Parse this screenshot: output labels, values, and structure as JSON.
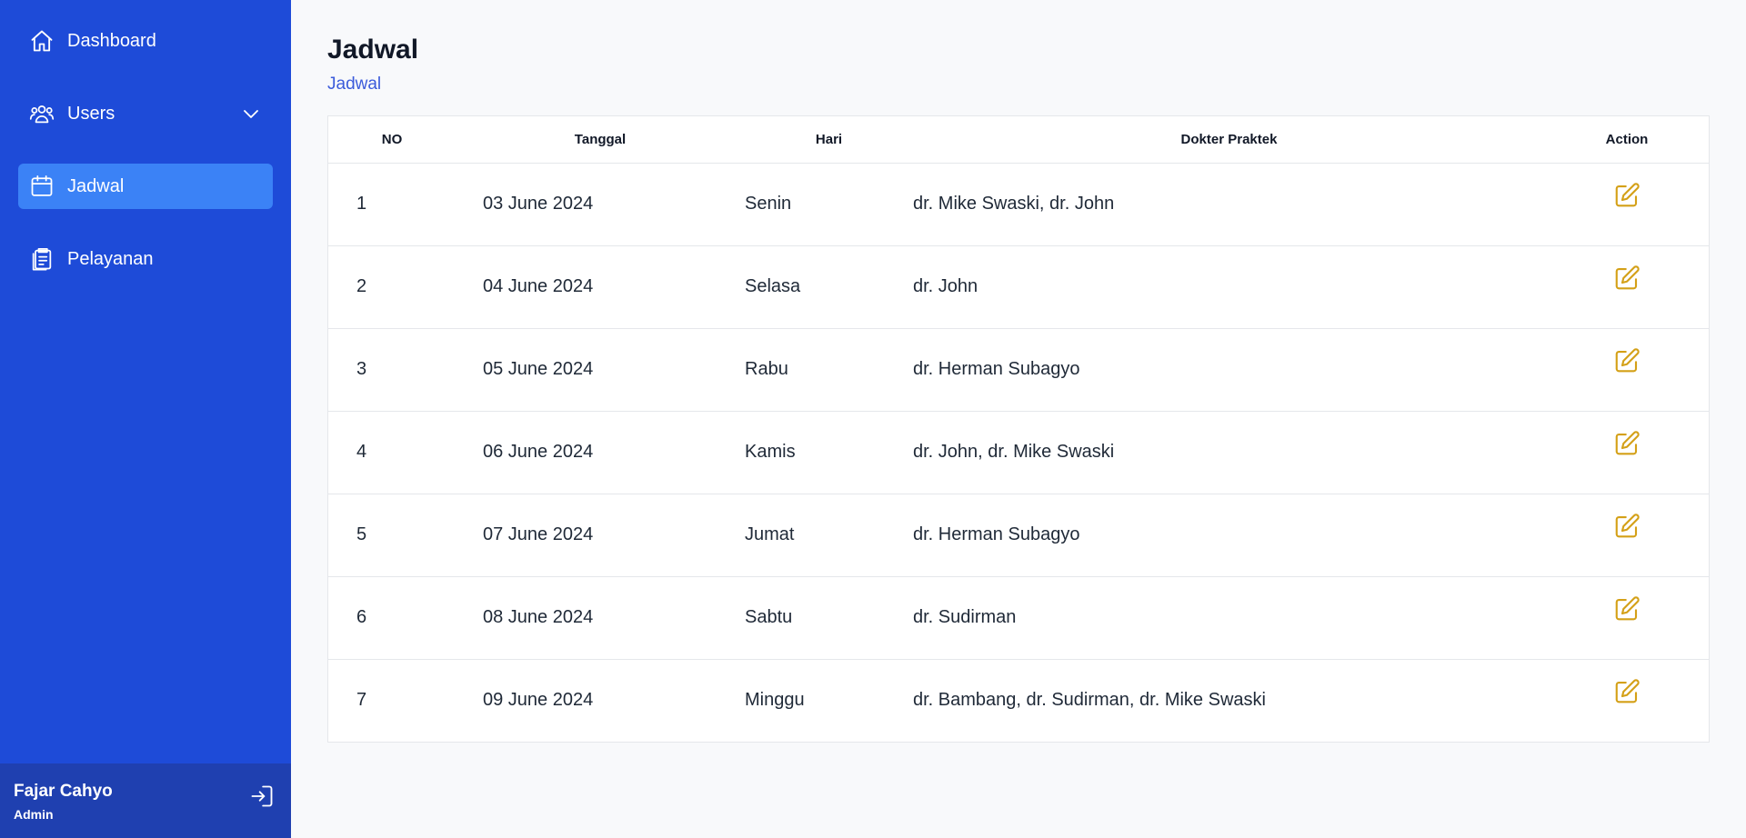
{
  "sidebar": {
    "items": [
      {
        "label": "Dashboard",
        "icon": "home-icon"
      },
      {
        "label": "Users",
        "icon": "users-icon",
        "has_dropdown": true
      },
      {
        "label": "Jadwal",
        "icon": "calendar-icon",
        "active": true
      },
      {
        "label": "Pelayanan",
        "icon": "clipboard-icon"
      }
    ],
    "user": {
      "name": "Fajar Cahyo",
      "role": "Admin"
    }
  },
  "page": {
    "title": "Jadwal",
    "breadcrumb": "Jadwal"
  },
  "table": {
    "headers": {
      "no": "NO",
      "tanggal": "Tanggal",
      "hari": "Hari",
      "dokter": "Dokter Praktek",
      "action": "Action"
    },
    "rows": [
      {
        "no": "1",
        "tanggal": "03 June 2024",
        "hari": "Senin",
        "dokter": "dr. Mike Swaski, dr. John"
      },
      {
        "no": "2",
        "tanggal": "04 June 2024",
        "hari": "Selasa",
        "dokter": "dr. John"
      },
      {
        "no": "3",
        "tanggal": "05 June 2024",
        "hari": "Rabu",
        "dokter": "dr. Herman Subagyo"
      },
      {
        "no": "4",
        "tanggal": "06 June 2024",
        "hari": "Kamis",
        "dokter": "dr. John, dr. Mike Swaski"
      },
      {
        "no": "5",
        "tanggal": "07 June 2024",
        "hari": "Jumat",
        "dokter": "dr. Herman Subagyo"
      },
      {
        "no": "6",
        "tanggal": "08 June 2024",
        "hari": "Sabtu",
        "dokter": "dr. Sudirman"
      },
      {
        "no": "7",
        "tanggal": "09 June 2024",
        "hari": "Minggu",
        "dokter": "dr. Bambang, dr. Sudirman, dr. Mike Swaski"
      }
    ]
  },
  "colors": {
    "sidebar_bg": "#1e4bd8",
    "active_item": "#3b82f6",
    "user_bg": "#1f40b0",
    "edit_icon": "#d4a017",
    "breadcrumb": "#3b5bdb"
  }
}
